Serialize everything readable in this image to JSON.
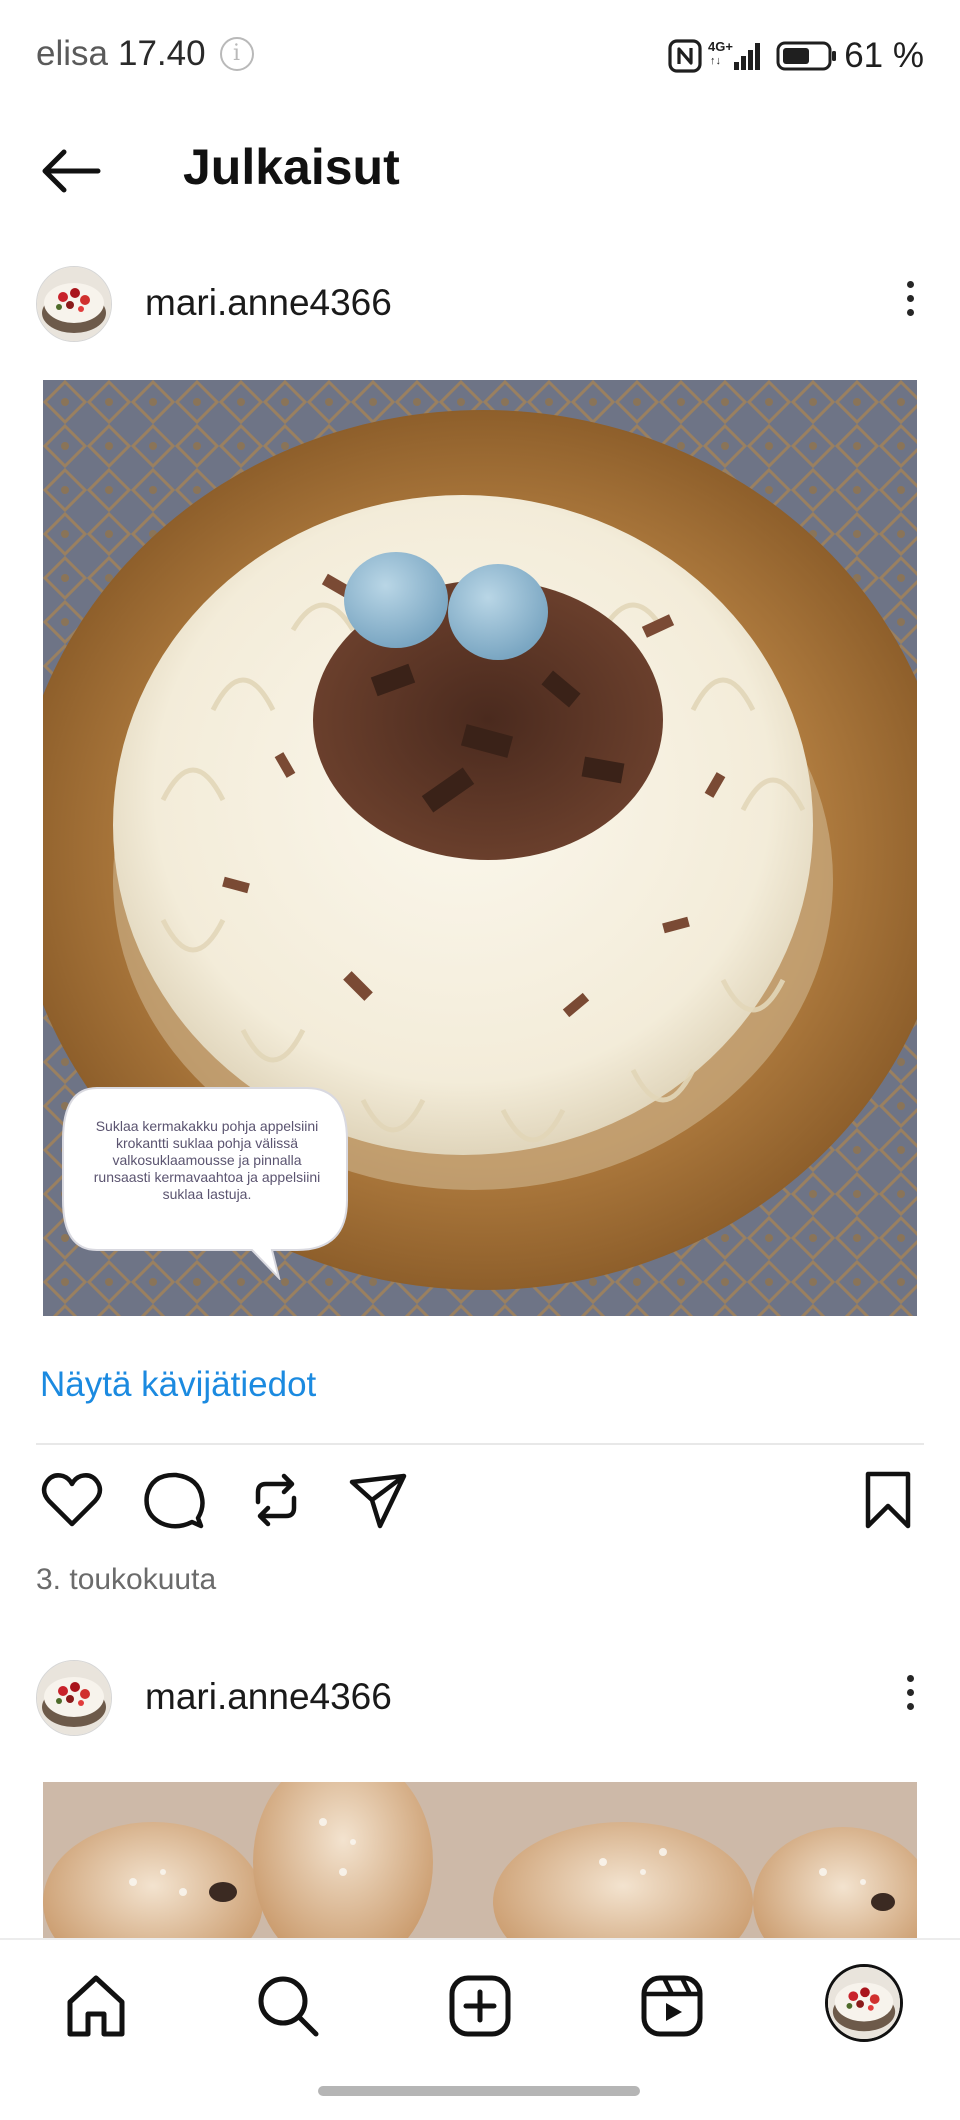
{
  "status_bar": {
    "carrier": "elisa",
    "time": "17.40",
    "info_icon": "info-icon",
    "nfc_icon": "nfc-icon",
    "network_label": "4G+",
    "signal_icon": "signal-icon",
    "battery_icon": "battery-icon",
    "battery_percent": "61 %",
    "battery_level": 0.61
  },
  "header": {
    "back_icon": "arrow-left-icon",
    "title": "Julkaisut"
  },
  "posts": [
    {
      "username": "mari.anne4366",
      "more_icon": "more-vertical-icon",
      "image_caption": "Suklaa kermakakku pohja appelsiini krokantti suklaa pohja välissä valkosuklaamousse ja pinnalla runsaasti kermavaahtoa ja appelsiini suklaa lastuja.",
      "insights_link": "Näytä kävijätiedot",
      "actions": {
        "like_icon": "heart-icon",
        "comment_icon": "comment-icon",
        "repost_icon": "repost-icon",
        "share_icon": "send-icon",
        "save_icon": "bookmark-icon"
      },
      "date": "3. toukokuuta"
    },
    {
      "username": "mari.anne4366",
      "more_icon": "more-vertical-icon"
    }
  ],
  "bottom_nav": {
    "items": [
      "home-icon",
      "search-icon",
      "create-icon",
      "reels-icon",
      "profile-avatar"
    ]
  },
  "colors": {
    "link_blue": "#1b8ae0",
    "text_primary": "#1a1a1a",
    "text_secondary": "#6b6b6b",
    "divider": "#e8e8e8"
  }
}
